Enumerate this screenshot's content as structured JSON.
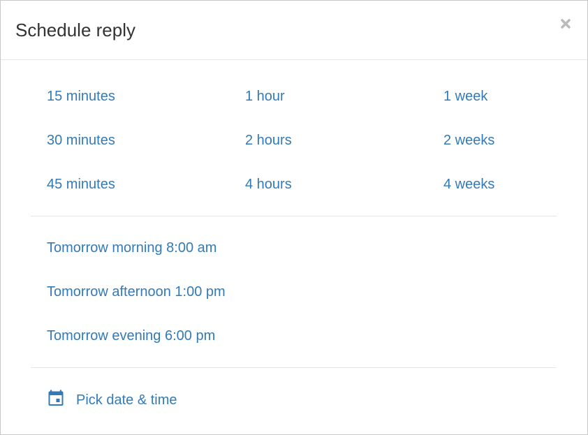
{
  "dialog": {
    "title": "Schedule reply",
    "close_label": "×"
  },
  "quick_options": {
    "col1": [
      "15 minutes",
      "30 minutes",
      "45 minutes"
    ],
    "col2": [
      "1 hour",
      "2 hours",
      "4 hours"
    ],
    "col3": [
      "1 week",
      "2 weeks",
      "4 weeks"
    ]
  },
  "tomorrow_options": [
    "Tomorrow morning 8:00 am",
    "Tomorrow afternoon 1:00 pm",
    "Tomorrow evening 6:00 pm"
  ],
  "pick": {
    "label": "Pick date & time",
    "icon": "calendar-icon"
  },
  "colors": {
    "link": "#337ab7",
    "title": "#333333",
    "divider": "#e5e5e5",
    "close": "#bbbbbb"
  }
}
